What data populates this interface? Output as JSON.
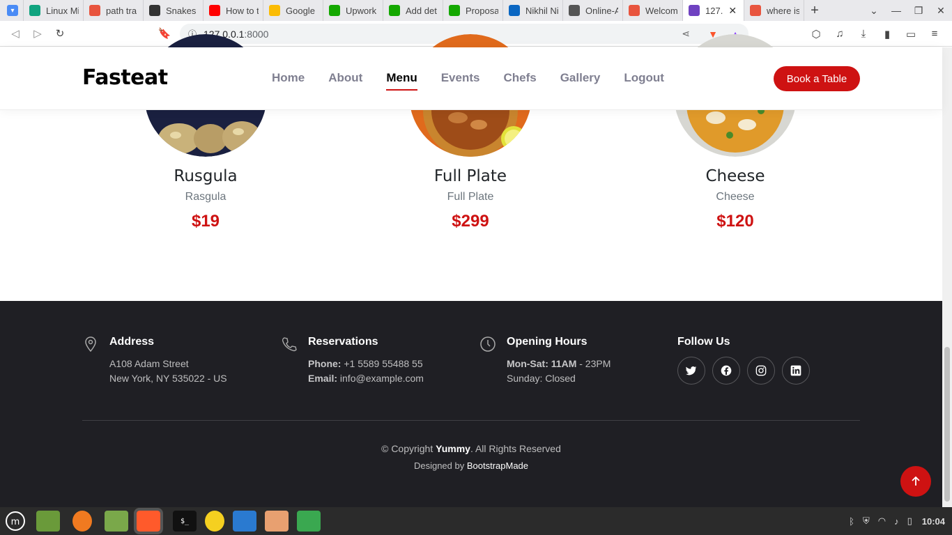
{
  "browser": {
    "tabs": [
      {
        "title": "Linux Mi",
        "icon": "chatgpt-icon",
        "color": "#10a37f"
      },
      {
        "title": "path tra",
        "icon": "brave-search-icon",
        "color": "#e8543e"
      },
      {
        "title": "Snakes a",
        "icon": "snake-icon",
        "color": "#333333"
      },
      {
        "title": "How to t",
        "icon": "youtube-icon",
        "color": "#ff0000"
      },
      {
        "title": "Google",
        "icon": "google-keep-icon",
        "color": "#fbbc04"
      },
      {
        "title": "Upwork",
        "icon": "upwork-icon",
        "color": "#14a800"
      },
      {
        "title": "Add det",
        "icon": "upwork-icon",
        "color": "#14a800"
      },
      {
        "title": "Proposa",
        "icon": "upwork-icon",
        "color": "#14a800"
      },
      {
        "title": "Nikhil Ni",
        "icon": "linkedin-icon",
        "color": "#0a66c2"
      },
      {
        "title": "Online-A",
        "icon": "globe-icon",
        "color": "#555555"
      },
      {
        "title": "Welcom",
        "icon": "flame-icon",
        "color": "#e8543e"
      },
      {
        "title": "127.",
        "icon": "bootstrap-icon",
        "color": "#6f42c1",
        "active": true
      },
      {
        "title": "where is",
        "icon": "brave-search-icon",
        "color": "#e8543e"
      }
    ],
    "url_host": "127.0.0.1",
    "url_port": ":8000"
  },
  "site": {
    "logo": "Fasteat",
    "nav": [
      "Home",
      "About",
      "Menu",
      "Events",
      "Chefs",
      "Gallery",
      "Logout"
    ],
    "active_nav": "Menu",
    "cta": "Book a Table",
    "accent_color": "#ce1212"
  },
  "menu_items": [
    {
      "name": "Rusgula",
      "desc": "Rasgula",
      "price": "$19"
    },
    {
      "name": "Full Plate",
      "desc": "Full Plate",
      "price": "$299"
    },
    {
      "name": "Cheese",
      "desc": "Cheese",
      "price": "$120"
    }
  ],
  "footer": {
    "address": {
      "title": "Address",
      "line1": "A108 Adam Street",
      "line2": "New York, NY 535022 - US"
    },
    "reservations": {
      "title": "Reservations",
      "phone_label": "Phone:",
      "phone": "+1 5589 55488 55",
      "email_label": "Email:",
      "email": "info@example.com"
    },
    "hours": {
      "title": "Opening Hours",
      "days_label": "Mon-Sat:",
      "open": "11AM",
      "close": "- 23PM",
      "sunday": "Sunday: Closed"
    },
    "follow": {
      "title": "Follow Us",
      "networks": [
        "twitter-icon",
        "facebook-icon",
        "instagram-icon",
        "linkedin-icon"
      ]
    },
    "copyright_prefix": "© Copyright",
    "brand": "Yummy",
    "copyright_suffix": ". All Rights Reserved",
    "designed_prefix": "Designed by",
    "designer": "BootstrapMade"
  },
  "taskbar": {
    "apps": [
      "mint-menu-icon",
      "desktop-icon",
      "firefox-icon",
      "files-icon",
      "brave-icon",
      "terminal-icon",
      "power-icon",
      "vscode-icon",
      "notes-icon",
      "shield-icon"
    ],
    "time": "10:04"
  }
}
